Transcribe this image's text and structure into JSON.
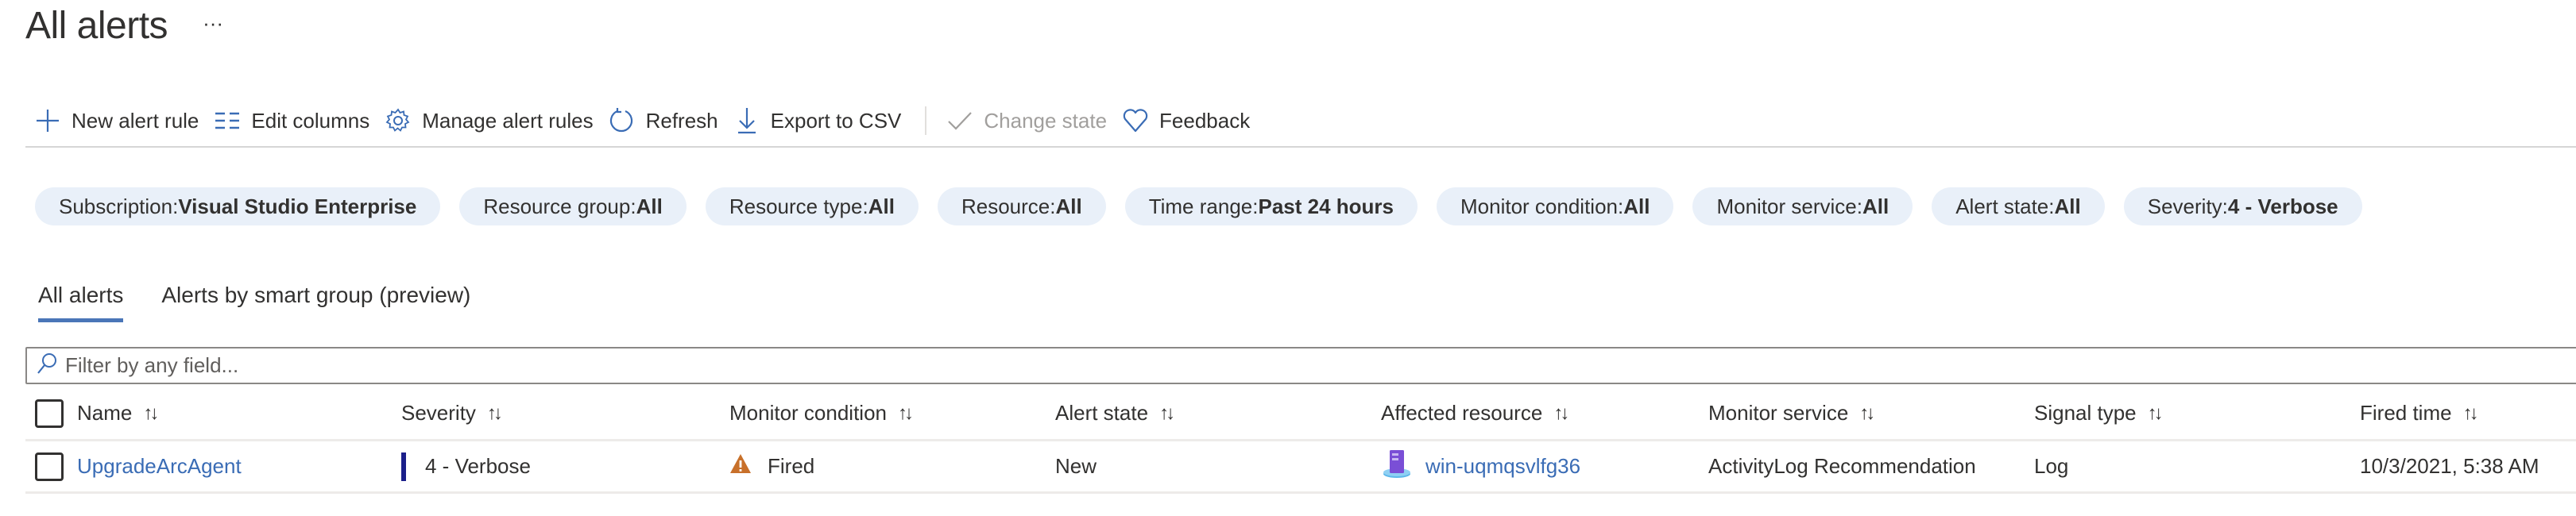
{
  "header": {
    "title": "All alerts",
    "more_label": "···"
  },
  "toolbar": {
    "items": [
      {
        "label": "New alert rule",
        "icon": "plus-icon",
        "disabled": false
      },
      {
        "label": "Edit columns",
        "icon": "edit-columns-icon",
        "disabled": false
      },
      {
        "label": "Manage alert rules",
        "icon": "gear-icon",
        "disabled": false
      },
      {
        "label": "Refresh",
        "icon": "refresh-icon",
        "disabled": false
      },
      {
        "label": "Export to CSV",
        "icon": "download-icon",
        "disabled": false
      },
      {
        "label": "Change state",
        "icon": "checkmark-icon",
        "disabled": true
      },
      {
        "label": "Feedback",
        "icon": "heart-icon",
        "disabled": false
      }
    ]
  },
  "filters": [
    {
      "key": "Subscription",
      "value": "Visual Studio Enterprise"
    },
    {
      "key": "Resource group",
      "value": "All"
    },
    {
      "key": "Resource type",
      "value": "All"
    },
    {
      "key": "Resource",
      "value": "All"
    },
    {
      "key": "Time range",
      "value": "Past 24 hours"
    },
    {
      "key": "Monitor condition",
      "value": "All"
    },
    {
      "key": "Monitor service",
      "value": "All"
    },
    {
      "key": "Alert state",
      "value": "All"
    },
    {
      "key": "Severity",
      "value": "4 - Verbose"
    }
  ],
  "filter_separator": " : ",
  "tabs": [
    {
      "label": "All alerts",
      "active": true
    },
    {
      "label": "Alerts by smart group (preview)",
      "active": false
    }
  ],
  "search": {
    "placeholder": "Filter by any field...",
    "value": ""
  },
  "table": {
    "columns": [
      "Name",
      "Severity",
      "Monitor condition",
      "Alert state",
      "Affected resource",
      "Monitor service",
      "Signal type",
      "Fired time"
    ],
    "sort_glyph": "↑↓",
    "rows": [
      {
        "name": "UpgradeArcAgent",
        "severity": "4 - Verbose",
        "monitor_condition": "Fired",
        "alert_state": "New",
        "affected_resource": "win-uqmqsvlfg36",
        "monitor_service": "ActivityLog Recommendation",
        "signal_type": "Log",
        "fired_time": "10/3/2021, 5:38 AM"
      }
    ]
  },
  "colors": {
    "accent": "#4a76b8",
    "link": "#3a6cb5",
    "pill_bg": "#e9f0f9",
    "severity_verbose": "#1b1f8a",
    "warning": "#c8702a"
  }
}
